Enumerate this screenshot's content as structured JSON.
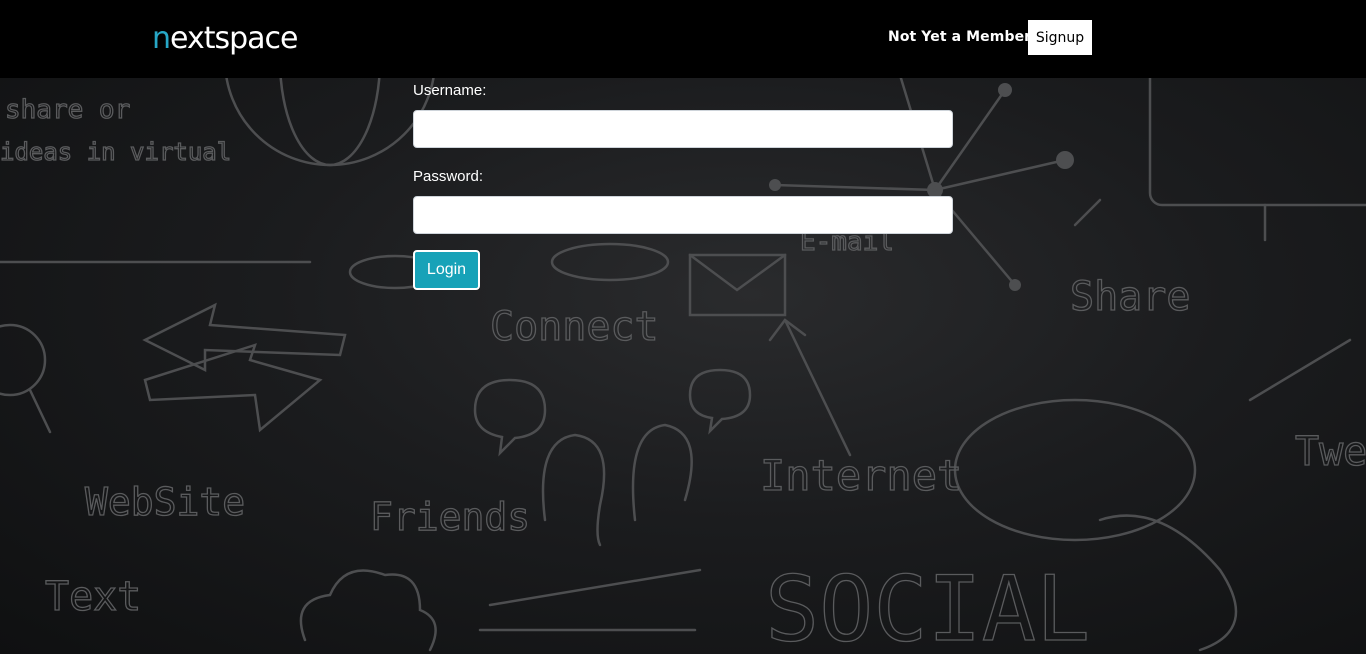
{
  "header": {
    "logo": {
      "prefix": "n",
      "rest": "extspace",
      "accent_color": "#27a7c6"
    },
    "member_prompt": "Not Yet a Member?",
    "signup_label": "Signup"
  },
  "login_form": {
    "username_label": "Username:",
    "username_value": "",
    "password_label": "Password:",
    "password_value": "",
    "login_label": "Login",
    "button_color": "#17a2b8"
  },
  "background": {
    "doodle_words": [
      "share or",
      "ideas in virtual",
      "Connect",
      "WebSite",
      "Friends",
      "Internet",
      "Share",
      "SOCIAL",
      "Text",
      "Twe",
      "E-mail"
    ]
  }
}
